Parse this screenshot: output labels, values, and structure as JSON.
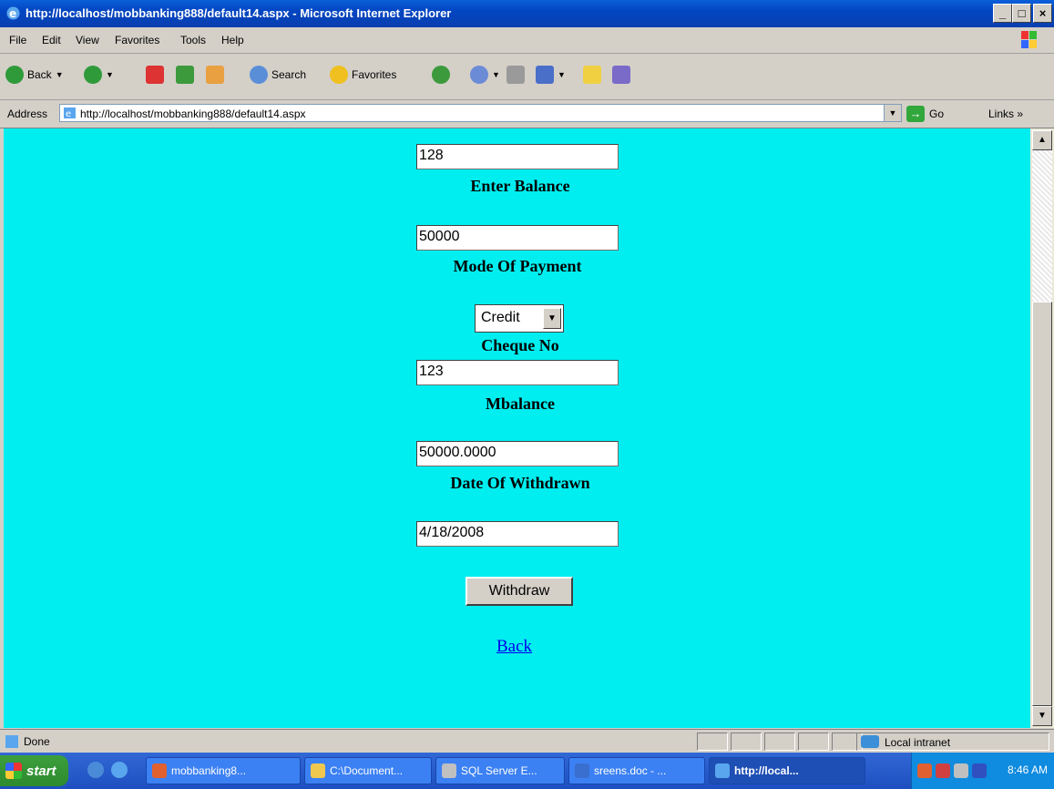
{
  "window": {
    "title": "http://localhost/mobbanking888/default14.aspx - Microsoft Internet Explorer",
    "min_glyph": "_",
    "max_glyph": "□",
    "close_glyph": "×"
  },
  "menu": {
    "items": [
      "File",
      "Edit",
      "View",
      "Favorites",
      "Tools",
      "Help"
    ]
  },
  "toolbar": {
    "back_label": "Back",
    "search_label": "Search",
    "favorites_label": "Favorites"
  },
  "address": {
    "label": "Address",
    "url": "http://localhost/mobbanking888/default14.aspx",
    "go_label": "Go",
    "links_label": "Links »"
  },
  "form": {
    "field1_value": "128",
    "balance_label": "Enter Balance",
    "balance_value": "50000",
    "mode_label": "Mode Of Payment",
    "mode_value": "Credit",
    "cheque_label": "Cheque No",
    "cheque_value": "123",
    "mbalance_label": "Mbalance",
    "mbalance_value": "50000.0000",
    "date_label": "Date Of Withdrawn",
    "date_value": "4/18/2008",
    "withdraw_button": "Withdraw",
    "back_link": "Back"
  },
  "status": {
    "text": "Done",
    "zone": "Local intranet"
  },
  "taskbar": {
    "start_label": "start",
    "tasks": [
      "mobbanking8...",
      "C:\\Document...",
      "SQL Server E...",
      "sreens.doc - ...",
      "http://local..."
    ],
    "clock": "8:46 AM"
  }
}
